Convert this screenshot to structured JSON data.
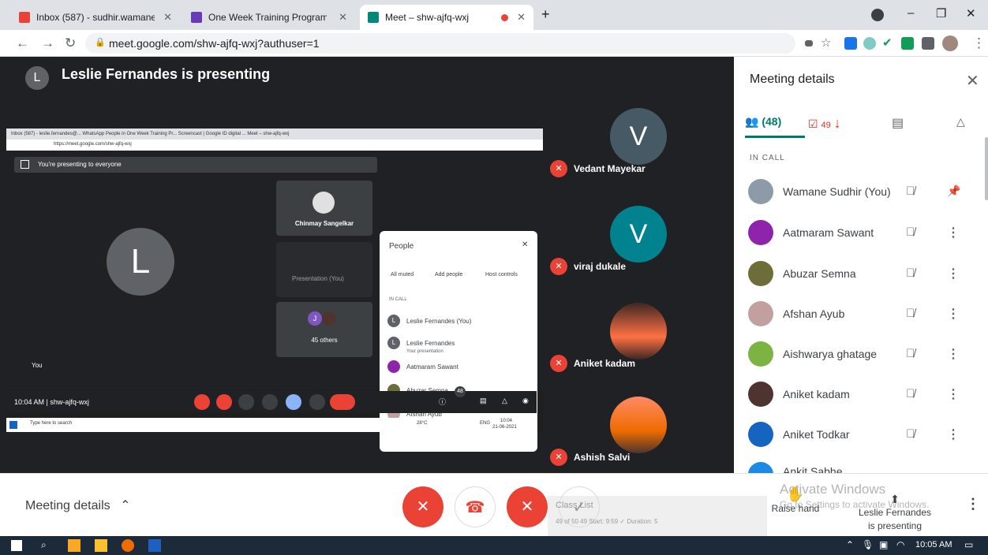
{
  "browser": {
    "tabs": [
      {
        "title": "Inbox (587) - sudhir.wamane@fa",
        "icon_color": "#ea4335"
      },
      {
        "title": "One Week Training Program on A",
        "icon_color": "#673ab7"
      },
      {
        "title": "Meet – shw-ajfq-wxj",
        "icon_color": "#00897b"
      }
    ],
    "url": "meet.google.com/shw-ajfq-wxj?authuser=1",
    "new_tab": "+",
    "minimize": "–",
    "maximize": "❐",
    "close": "✕"
  },
  "stage": {
    "presenter_initial": "L",
    "presenter_banner": "Leslie Fernandes is presenting"
  },
  "shared_screen": {
    "tabbar_text": "Inbox (587) - leslie.fernandes@...   WhatsApp   People in One Week Training Pr...   Screencast | Google ID digital ...   Meet – shw-ajfq-wxj",
    "url": "https://meet.google.com/shw-ajfq-wxj",
    "banner": "You're presenting to everyone",
    "self_initial": "L",
    "self_label": "You",
    "tile_chinmay": "Chinmay Sangelkar",
    "tile_presentation": "Presentation (You)",
    "tile_others_initial": "J",
    "tile_others": "45 others",
    "bottom_info": "10:04 AM  |  shw-ajfq-wxj",
    "people_title": "People",
    "people_actions": [
      "All muted",
      "Add people",
      "Host controls"
    ],
    "people_incall": "IN CALL",
    "people": [
      {
        "initial": "L",
        "name": "Leslie Fernandes (You)",
        "sub": ""
      },
      {
        "initial": "L",
        "name": "Leslie Fernandes",
        "sub": "Your presentation"
      },
      {
        "initial": "A",
        "name": "Aatmaram Sawant",
        "sub": ""
      },
      {
        "initial": "A",
        "name": "Abuzar Semna",
        "sub": ""
      },
      {
        "initial": "A",
        "name": "Afshan Ayub",
        "sub": ""
      }
    ],
    "participant_badge": "48",
    "taskbar_search": "Type here to search",
    "taskbar_weather": "28°C",
    "taskbar_lang": "ENG",
    "taskbar_time": "10:04",
    "taskbar_date": "21-06-2021"
  },
  "participants": [
    {
      "initial": "V",
      "name": "Vedant Mayekar",
      "color": "#455a64"
    },
    {
      "initial": "V",
      "name": "viraj dukale",
      "color": "#00838f"
    },
    {
      "initial": "",
      "name": "Aniket kadam",
      "color": "#6d4c41"
    },
    {
      "initial": "",
      "name": "Ashish Salvi",
      "color": "#d84315"
    }
  ],
  "panel": {
    "title": "Meeting details",
    "close": "✕",
    "people_count": "(48)",
    "tasks_count": "49",
    "in_call": "IN CALL",
    "people": [
      {
        "name": "Wamane Sudhir (You)",
        "action": "pin",
        "color": "#8d9aa8"
      },
      {
        "name": "Aatmaram Sawant",
        "action": "more",
        "color": "#8e24aa"
      },
      {
        "name": "Abuzar Semna",
        "action": "more",
        "color": "#6d6d3a"
      },
      {
        "name": "Afshan Ayub",
        "action": "more",
        "color": "#c2a0a0"
      },
      {
        "name": "Aishwarya ghatage",
        "action": "more",
        "color": "#7cb342"
      },
      {
        "name": "Aniket kadam",
        "action": "more",
        "color": "#4e342e"
      },
      {
        "name": "Aniket Todkar",
        "action": "more",
        "color": "#1565c0"
      },
      {
        "name": "Ankit Sabhe",
        "action": "more",
        "color": "#1e88e5"
      }
    ]
  },
  "meetbar": {
    "details_label": "Meeting details",
    "raise_hand": "Raise hand",
    "presenting_note": "Leslie Fernandes is presenting",
    "activate_windows": "Activate Windows",
    "activate_sub": "Go to Settings to activate Windows.",
    "overlay_text": "Class List",
    "overlay_sub": "49 of 50   49   Start: 9:59 ✓ Duration: 5"
  },
  "taskbar": {
    "time": "10:05 AM"
  },
  "colors": {
    "meet_red": "#ea4335",
    "meet_teal": "#00796b",
    "dark_bg": "#202124"
  }
}
